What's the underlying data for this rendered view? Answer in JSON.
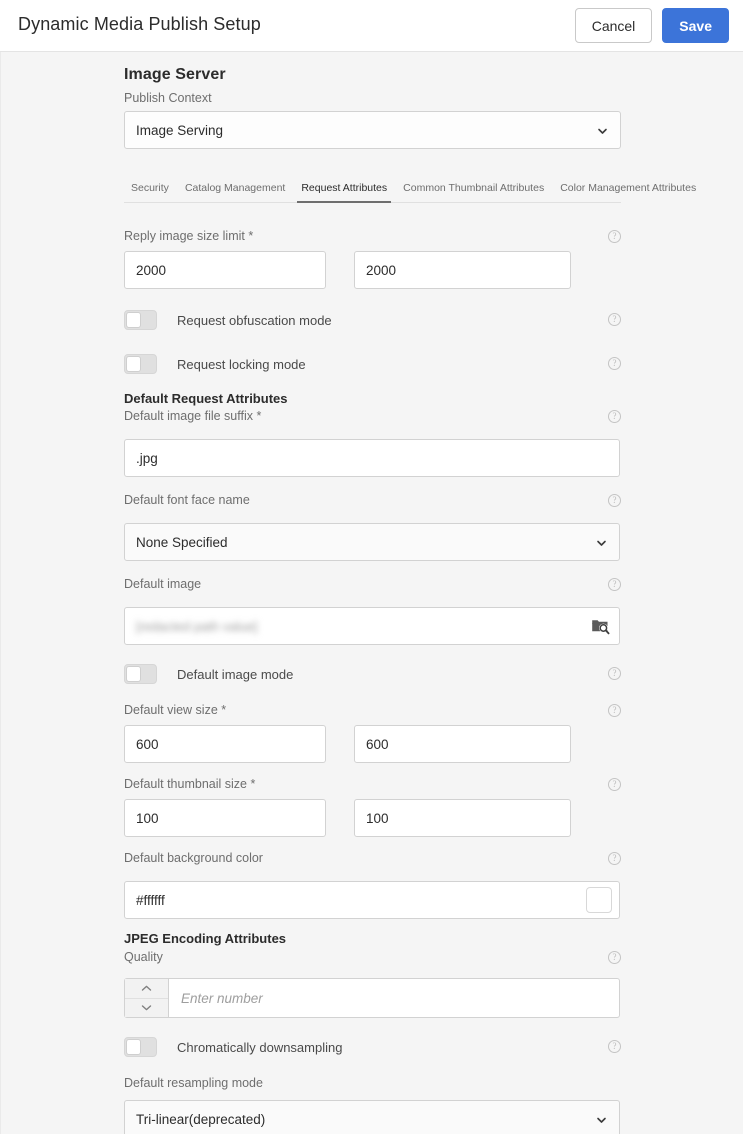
{
  "header": {
    "title": "Dynamic Media Publish Setup",
    "cancel_label": "Cancel",
    "save_label": "Save",
    "save_color": "#3c74d9"
  },
  "panel": {
    "section_title": "Image Server",
    "publish_context": {
      "label": "Publish Context",
      "value": "Image Serving"
    },
    "tabs": [
      {
        "label": "Security",
        "active": false
      },
      {
        "label": "Catalog Management",
        "active": false
      },
      {
        "label": "Request Attributes",
        "active": true
      },
      {
        "label": "Common Thumbnail Attributes",
        "active": false
      },
      {
        "label": "Color Management Attributes",
        "active": false
      }
    ],
    "fields": {
      "reply_image_size_limit": {
        "label": "Reply image size limit *",
        "value_width": "2000",
        "value_height": "2000"
      },
      "request_obfuscation_mode": {
        "label": "Request obfuscation mode",
        "state": "off"
      },
      "request_locking_mode": {
        "label": "Request locking mode",
        "state": "off"
      },
      "default_request_attributes_heading": "Default Request Attributes",
      "default_image_file_suffix": {
        "label": "Default image file suffix *",
        "value": ".jpg"
      },
      "default_font_face_name": {
        "label": "Default font face name",
        "value": "None Specified"
      },
      "default_image": {
        "label": "Default image",
        "value": "[redacted path value]",
        "redacted": true
      },
      "default_image_mode": {
        "label": "Default image mode",
        "state": "off"
      },
      "default_view_size": {
        "label": "Default view size *",
        "value_width": "600",
        "value_height": "600"
      },
      "default_thumbnail_size": {
        "label": "Default thumbnail size *",
        "value_width": "100",
        "value_height": "100"
      },
      "default_background_color": {
        "label": "Default background color",
        "value": "#ffffff",
        "swatch_color": "#ffffff"
      },
      "jpeg_encoding_attributes_heading": "JPEG Encoding Attributes",
      "quality": {
        "label": "Quality",
        "value": "",
        "placeholder": "Enter number"
      },
      "chromatically_downsampling": {
        "label": "Chromatically downsampling",
        "state": "off"
      },
      "default_resampling_mode": {
        "label": "Default resampling mode",
        "value": "Tri-linear(deprecated)"
      }
    },
    "help_icon_glyph": "?"
  }
}
